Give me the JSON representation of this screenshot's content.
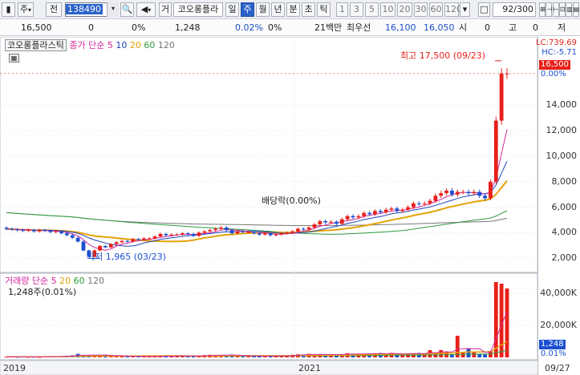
{
  "toolbar": {
    "btn_chart": "▮",
    "type": "주",
    "type_arrow": "▾",
    "jeon": "전",
    "code": "138490",
    "code_dropdown": "▾",
    "search": "🔍",
    "speaker": "◀",
    "speaker_arrow": "▾",
    "geo": "거",
    "name": "코오롱플라",
    "periods": [
      "일",
      "주",
      "월",
      "년",
      "분",
      "초",
      "틱"
    ],
    "active_period": "주",
    "intervals": [
      "1",
      "3",
      "5",
      "10",
      "20",
      "30",
      "60",
      "120"
    ],
    "interval_dropdown": "▾",
    "count": "92",
    "count_total": "/300",
    "tool_icons": [
      "⊞",
      "⊣",
      "⊢",
      "⊡",
      "▥",
      "▤"
    ]
  },
  "infobar": {
    "close": "16,500",
    "change": "0",
    "change_pct": "0%",
    "volume": "1,248",
    "volume_pct": "0.02%",
    "turnover_pct": "0%",
    "trade_value": "21백만",
    "priority_label": "최우선",
    "ask": "16,100",
    "bid": "16,050",
    "open_label": "시",
    "open": "0",
    "high_label": "고",
    "high": "0",
    "low_label": "저"
  },
  "price_panel": {
    "name": "코오롱플라스틱",
    "ma_label": "종가 단순",
    "ma_periods": [
      "5",
      "10",
      "20",
      "60",
      "120"
    ],
    "high_annotation": "최고 17,500 (09/23)",
    "low_annotation": "최저 1,965 (03/23)",
    "dividend_annotation": "배당락(0.00%)",
    "lc": "LC:739.69",
    "hc": "HC:-5.71",
    "last_price": "16,500",
    "last_pct": "0.00%",
    "ticks": [
      "14,000",
      "12,000",
      "10,000",
      "8,000",
      "6,000",
      "4,000",
      "2,000"
    ]
  },
  "volume_panel": {
    "name": "거래량",
    "ma_label": "단순",
    "ma_periods": [
      "5",
      "20",
      "60",
      "120"
    ],
    "current": "1,248주(0.01%)",
    "ticks": [
      "40,000K",
      "20,000K"
    ],
    "last_vol": "1,248",
    "last_pct": "0.01%"
  },
  "dates": [
    "2019",
    "2021",
    "09/27"
  ],
  "colors": {
    "up": "#e8201a",
    "down": "#1c4fd0",
    "ma5": "#d4259a",
    "ma10": "#1c45b8",
    "ma20": "#e3a206",
    "ma60": "#2e9a3c",
    "ma120": "#777777"
  },
  "chart_data": {
    "type": "candlestick",
    "period": "weekly",
    "ylim": [
      1000,
      18500
    ],
    "y_ticks": [
      2000,
      4000,
      6000,
      8000,
      10000,
      12000,
      14000
    ],
    "high": 17500,
    "low": 1965,
    "last_close": 16500,
    "close": [
      4300,
      4250,
      4200,
      4150,
      4200,
      4100,
      4200,
      4150,
      4050,
      4100,
      3950,
      3800,
      3600,
      3300,
      2600,
      2100,
      2600,
      2950,
      2850,
      3100,
      3250,
      3350,
      3300,
      3500,
      3450,
      3550,
      3550,
      3700,
      3900,
      3800,
      3850,
      3850,
      3950,
      3900,
      3750,
      4000,
      4100,
      4200,
      4300,
      4400,
      4200,
      3950,
      4100,
      4050,
      4050,
      3950,
      3850,
      3950,
      3800,
      3850,
      3950,
      4000,
      4100,
      4300,
      4250,
      4400,
      4650,
      4900,
      4800,
      4850,
      4700,
      5050,
      5300,
      5200,
      5300,
      5550,
      5450,
      5700,
      5600,
      5800,
      5900,
      5700,
      5800,
      6000,
      6300,
      6250,
      6300,
      6500,
      6900,
      7100,
      7300,
      7000,
      7200,
      7200,
      7100,
      7200,
      6900,
      6700,
      8000,
      12800,
      16500,
      16500
    ],
    "volume_k": [
      400,
      500,
      300,
      450,
      300,
      350,
      250,
      800,
      600,
      500,
      700,
      900,
      1200,
      2200,
      1500,
      1200,
      1100,
      1300,
      1700,
      900,
      700,
      600,
      500,
      600,
      800,
      700,
      600,
      500,
      900,
      1000,
      700,
      1300,
      1000,
      800,
      800,
      900,
      1400,
      1600,
      1500,
      1300,
      1300,
      1800,
      900,
      800,
      700,
      900,
      1100,
      600,
      700,
      1000,
      900,
      1200,
      1600,
      1900,
      1800,
      2200,
      1500,
      1900,
      1700,
      1800,
      1700,
      2000,
      2600,
      2200,
      1900,
      2000,
      2500,
      2600,
      2700,
      1600,
      2800,
      2100,
      1800,
      2400,
      2600,
      2800,
      2400,
      4500,
      2100,
      4600,
      3600,
      1900,
      13500,
      3100,
      5400,
      3200,
      2100,
      1900,
      4000,
      47000,
      46000,
      43000
    ],
    "volume_ylim": [
      0,
      50000
    ],
    "volume_ticks": [
      20000,
      40000
    ]
  }
}
